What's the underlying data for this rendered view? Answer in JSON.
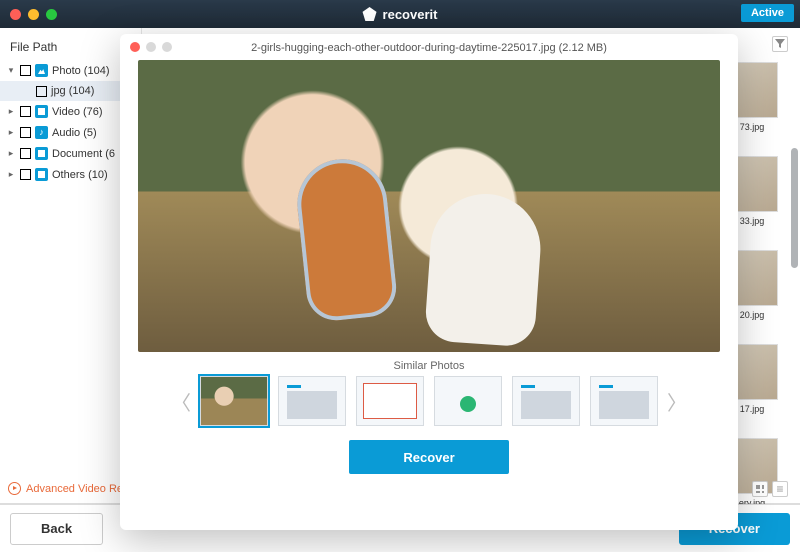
{
  "header": {
    "brand": "recoverit",
    "active_label": "Active"
  },
  "sidebar": {
    "title": "File Path",
    "items": [
      {
        "label": "Photo (104)",
        "icon": "photo",
        "expanded": true
      },
      {
        "label": "jpg (104)",
        "icon": "",
        "child": true
      },
      {
        "label": "Video (76)",
        "icon": "video"
      },
      {
        "label": "Audio (5)",
        "icon": "audio"
      },
      {
        "label": "Document (6",
        "icon": "doc"
      },
      {
        "label": "Others (10)",
        "icon": "other"
      }
    ],
    "advanced_link": "Advanced Video Rec"
  },
  "grid": {
    "thumbs": [
      {
        "name": "73.jpg"
      },
      {
        "name": "33.jpg"
      },
      {
        "name": "20.jpg"
      },
      {
        "name": "17.jpg"
      },
      {
        "name": "ery.jpg"
      }
    ]
  },
  "footer": {
    "back_label": "Back",
    "recover_label": "Recover"
  },
  "modal": {
    "filename": "2-girls-hugging-each-other-outdoor-during-daytime-225017.jpg (2.12 MB)",
    "similar_heading": "Similar Photos",
    "recover_label": "Recover",
    "thumbnails": [
      {
        "kind": "photo",
        "selected": true
      },
      {
        "kind": "app"
      },
      {
        "kind": "doc"
      },
      {
        "kind": "green"
      },
      {
        "kind": "app"
      },
      {
        "kind": "app"
      }
    ]
  }
}
